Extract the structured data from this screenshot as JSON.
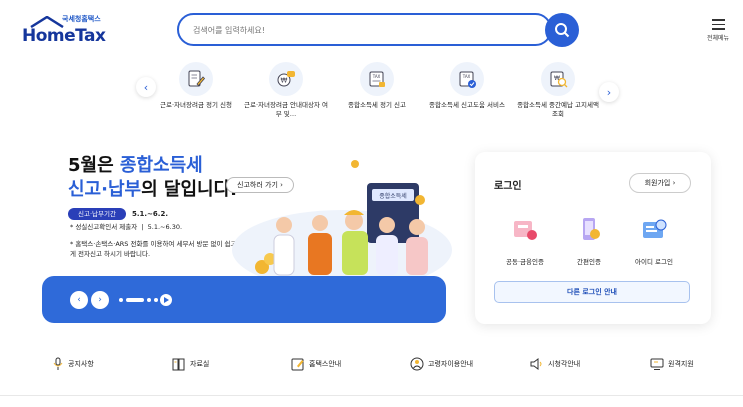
{
  "header": {
    "logo_small": "국세청홈택스",
    "logo_big": "HomeTax",
    "search_placeholder": "검색어를 입력하세요!",
    "menu_label": "전체메뉴"
  },
  "quick_menu": [
    {
      "label": "근로·자녀장려금 정기 신청",
      "icon": "edit-document-icon"
    },
    {
      "label": "근로·자녀장려금 안내대상자 여부 및…",
      "icon": "won-chat-icon"
    },
    {
      "label": "종합소득세 정기 신고",
      "icon": "tax-form-icon"
    },
    {
      "label": "종합소득세 신고도움 서비스",
      "icon": "tax-check-icon"
    },
    {
      "label": "종합소득세 중간예납 고지세액 조회",
      "icon": "won-search-icon"
    }
  ],
  "banner": {
    "line1_pre": "5월은 ",
    "line1_hl": "종합소득세",
    "line2_hl": "신고·납부",
    "line2_post": "의 달입니다.",
    "go_button": "신고하러 가기",
    "period_badge": "신고·납부기간",
    "period_value": "5.1.~6.2.",
    "note1_label": "* 성실신고확인서 제출자",
    "note1_value": "5.1.~6.30.",
    "note2": "* 홈택스·손택스·ARS 전화를 이용하여 세무서 방문 없이 쉽고 편리하게 전자신고 하시기 바랍니다.",
    "calculator_label": "종합소득세"
  },
  "login": {
    "title": "로그인",
    "signup": "회원가입",
    "options": [
      {
        "label": "공동·금융인증",
        "icon": "certificate-icon"
      },
      {
        "label": "간편인증",
        "icon": "mobile-auth-icon"
      },
      {
        "label": "아이디 로그인",
        "icon": "id-login-icon"
      }
    ],
    "other": "다른 로그인 안내"
  },
  "bottom_nav": [
    {
      "label": "공지사항",
      "icon": "microphone-icon"
    },
    {
      "label": "자료실",
      "icon": "archive-icon"
    },
    {
      "label": "홈택스안내",
      "icon": "guide-icon"
    },
    {
      "label": "고령자이용안내",
      "icon": "senior-icon"
    },
    {
      "label": "시청각안내",
      "icon": "speaker-icon"
    },
    {
      "label": "원격지원",
      "icon": "monitor-icon"
    }
  ],
  "colors": {
    "primary": "#2a5fd6",
    "navy": "#15369c",
    "banner_blue": "#2f6ad9"
  }
}
